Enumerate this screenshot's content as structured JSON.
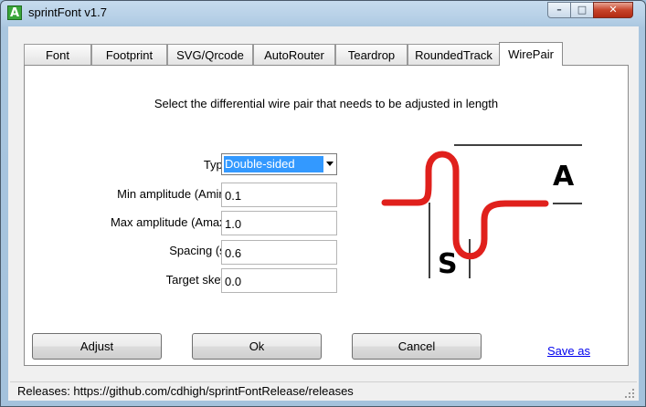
{
  "window": {
    "title": "sprintFont v1.7",
    "app_icon_glyph": "A",
    "min_glyph": "–",
    "max_glyph": "□",
    "close_glyph": "✕"
  },
  "tabs": [
    {
      "label": "Font"
    },
    {
      "label": "Footprint"
    },
    {
      "label": "SVG/Qrcode"
    },
    {
      "label": "AutoRouter"
    },
    {
      "label": "Teardrop"
    },
    {
      "label": "RoundedTrack"
    },
    {
      "label": "WirePair",
      "active": true
    }
  ],
  "panel": {
    "instruction": "Select the differential wire pair that needs to be adjusted in length",
    "type_label": "Type",
    "type_value": "Double-sided",
    "min_amp_label": "Min amplitude (Amin)",
    "min_amp_value": "0.1",
    "max_amp_label": "Max amplitude (Amax)",
    "max_amp_value": "1.0",
    "spacing_label": "Spacing (s)",
    "spacing_value": "0.6",
    "skew_label": "Target skew",
    "skew_value": "0.0",
    "diagram": {
      "label_a": "A",
      "label_s": "S",
      "trace_color": "#e0201c"
    }
  },
  "buttons": {
    "adjust": "Adjust",
    "ok": "Ok",
    "cancel": "Cancel",
    "save_as": "Save as"
  },
  "status": {
    "text": "Releases: https://github.com/cdhigh/sprintFontRelease/releases"
  }
}
